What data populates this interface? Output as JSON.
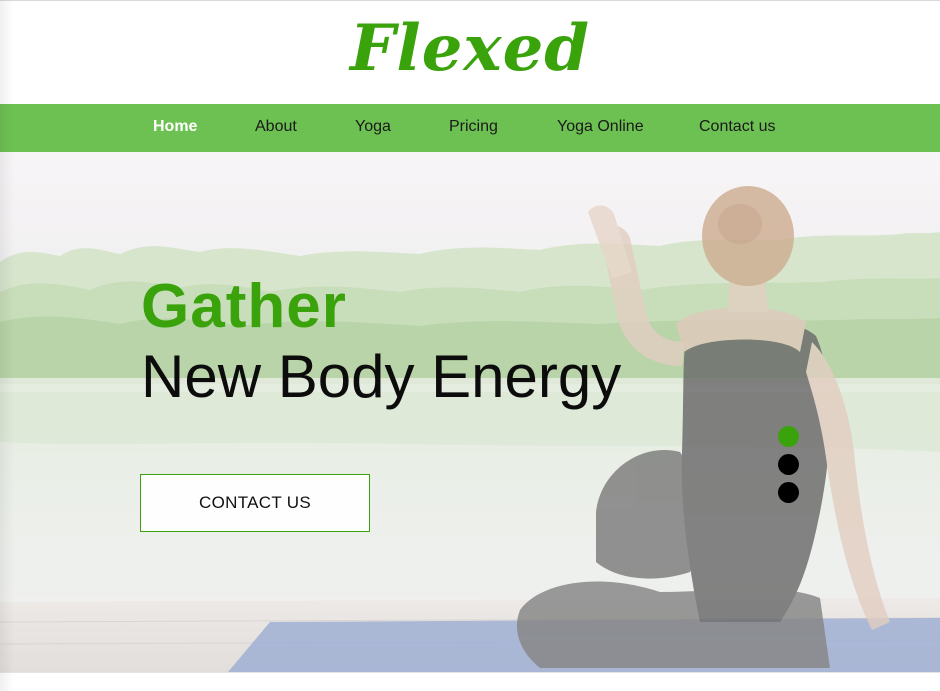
{
  "brand": {
    "logo_text": "Flexed",
    "accent_color": "#3aa30b",
    "nav_color": "#6dc152"
  },
  "nav": {
    "items": [
      {
        "label": "Home",
        "active": true
      },
      {
        "label": "About",
        "active": false
      },
      {
        "label": "Yoga",
        "active": false
      },
      {
        "label": "Pricing",
        "active": false
      },
      {
        "label": "Yoga Online",
        "active": false
      },
      {
        "label": "Contact us",
        "active": false
      }
    ]
  },
  "hero": {
    "headline_line1": "Gather",
    "headline_line2": "New Body Energy",
    "cta_label": "CONTACT US",
    "image_subject": "woman doing a seated yoga twist on a lakeside dock",
    "slides": {
      "count": 3,
      "active_index": 0
    }
  }
}
